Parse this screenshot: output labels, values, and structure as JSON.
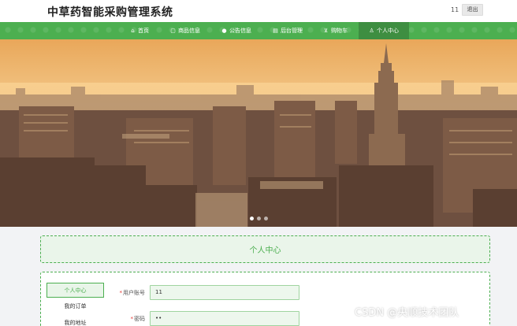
{
  "header": {
    "site_title": "中草药智能采购管理系统",
    "user_id": "11",
    "logout_label": "退出"
  },
  "nav": {
    "items": [
      {
        "label": "首页",
        "icon": "home-icon",
        "glyph": "⌂"
      },
      {
        "label": "商品信息",
        "icon": "bag-icon",
        "glyph": "▢"
      },
      {
        "label": "公告信息",
        "icon": "bullet-icon",
        "glyph": "●"
      },
      {
        "label": "后台管理",
        "icon": "dashboard-icon",
        "glyph": "▤"
      },
      {
        "label": "购物车",
        "icon": "cart-icon",
        "glyph": "⊻"
      },
      {
        "label": "个人中心",
        "icon": "user-icon",
        "glyph": "♙"
      }
    ],
    "active_index": 5
  },
  "banner": {
    "slide_count": 3,
    "active_slide": 0
  },
  "personal_center": {
    "title": "个人中心",
    "menu": [
      {
        "label": "个人中心",
        "active": true
      },
      {
        "label": "我的订单",
        "active": false
      },
      {
        "label": "我的地址",
        "active": false
      }
    ],
    "fields": {
      "account": {
        "label": "用户账号",
        "value": "11",
        "required": true
      },
      "password": {
        "label": "密码",
        "value": "••",
        "required": true
      }
    }
  },
  "watermark": "CSDN @央顺技术团队",
  "colors": {
    "accent": "#4caf50",
    "accent_dark": "#3e8e41",
    "required": "#e53935"
  }
}
